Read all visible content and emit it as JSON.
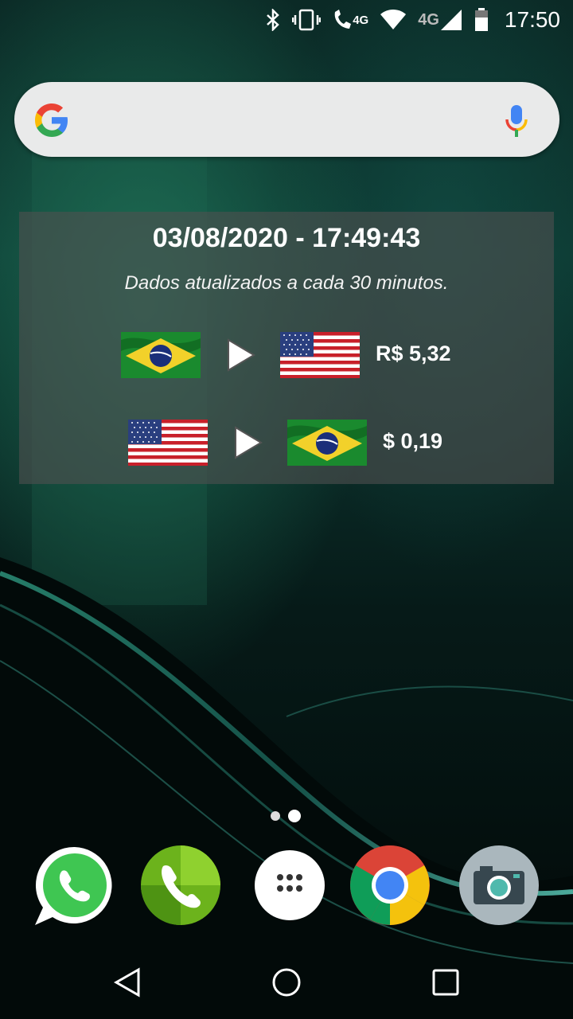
{
  "status_bar": {
    "time": "17:50",
    "network_1": "4G",
    "network_2": "4G",
    "icons": [
      "bluetooth-icon",
      "vibrate-icon",
      "wifi-calling-icon",
      "wifi-icon",
      "cell-signal-icon",
      "battery-icon"
    ]
  },
  "search_bar": {
    "logo": "google-logo-icon",
    "mic": "mic-icon"
  },
  "widget": {
    "datetime": "03/08/2020 - 17:49:43",
    "subtitle": "Dados atualizados a cada 30 minutos.",
    "rows": [
      {
        "from_flag": "brazil-flag-icon",
        "to_flag": "usa-flag-icon",
        "value": "R$ 5,32"
      },
      {
        "from_flag": "usa-flag-icon",
        "to_flag": "brazil-flag-icon",
        "value": "$ 0,19"
      }
    ]
  },
  "pager": {
    "pages": 2,
    "active": 2
  },
  "dock": {
    "apps": [
      "whatsapp-icon",
      "phone-icon",
      "app-drawer-icon",
      "chrome-icon",
      "camera-icon"
    ]
  },
  "nav_bar": {
    "buttons": [
      "back-icon",
      "home-icon",
      "recents-icon"
    ]
  },
  "colors": {
    "widget_bg": "#505050",
    "search_bg": "#e9eaea"
  }
}
